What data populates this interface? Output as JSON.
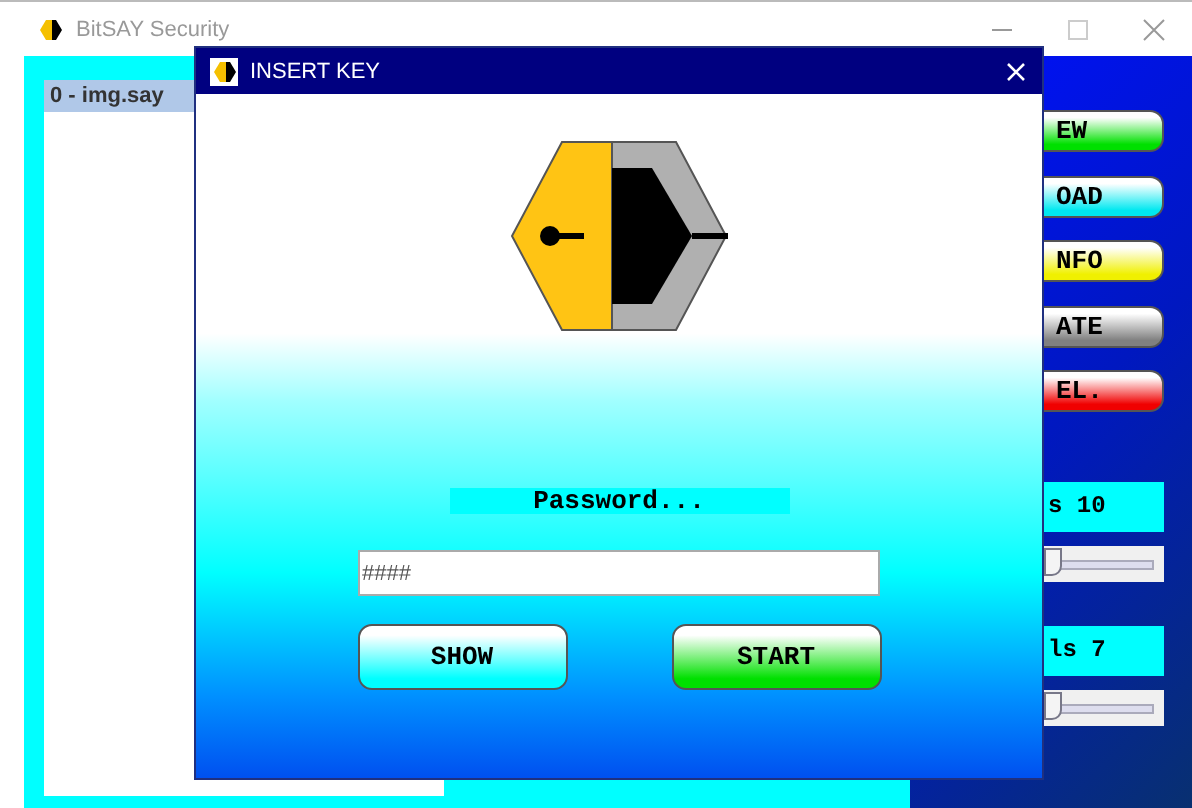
{
  "window": {
    "title": "BitSAY Security"
  },
  "file_list": {
    "items": [
      {
        "label": "0 - img.say",
        "selected": true
      }
    ]
  },
  "side_buttons": [
    {
      "label": "EW",
      "color": "#00e000"
    },
    {
      "label": "OAD",
      "color": "#00e8f0"
    },
    {
      "label": "NFO",
      "color": "#f0f000"
    },
    {
      "label": "ATE",
      "color": "#808080"
    },
    {
      "label": "EL.",
      "color": "#f00000"
    }
  ],
  "settings": [
    {
      "label": "s 10",
      "slider": {
        "level": 0
      }
    },
    {
      "label": "ls 7",
      "slider": {
        "level": 0
      }
    }
  ],
  "dialog": {
    "title": "INSERT KEY",
    "prompt": "Password...",
    "password": {
      "value": "####"
    },
    "buttons": [
      {
        "label": "SHOW",
        "color": "#00ffff"
      },
      {
        "label": "START",
        "color": "#00e000"
      }
    ]
  }
}
